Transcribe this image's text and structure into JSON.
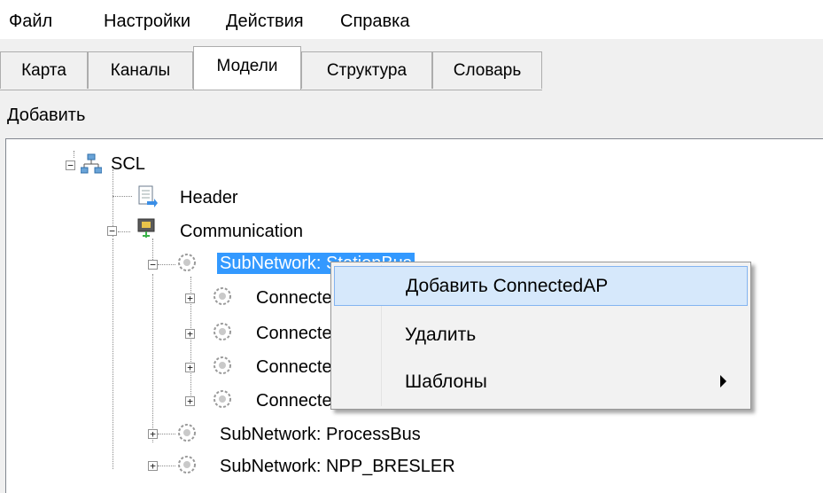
{
  "menubar": {
    "items": [
      "Файл",
      "Настройки",
      "Действия",
      "Справка"
    ]
  },
  "tabs": {
    "items": [
      "Карта",
      "Каналы",
      "Модели",
      "Структура",
      "Словарь"
    ],
    "active": "Модели"
  },
  "toolbar": {
    "add_label": "Добавить"
  },
  "tree": {
    "nodes": [
      {
        "label": "SCL",
        "expanded": true,
        "icon": "network-icon"
      },
      {
        "label": "Header",
        "icon": "document-icon"
      },
      {
        "label": "Communication",
        "expanded": true,
        "icon": "ethernet-port-icon"
      },
      {
        "label": "SubNetwork: StationBus",
        "expanded": true,
        "selected": true,
        "icon": "subnetwork-icon"
      },
      {
        "label": "ConnectedAP",
        "icon": "subnetwork-icon"
      },
      {
        "label": "ConnectedAP",
        "icon": "subnetwork-icon"
      },
      {
        "label": "ConnectedAP",
        "icon": "subnetwork-icon"
      },
      {
        "label": "ConnectedAP",
        "icon": "subnetwork-icon"
      },
      {
        "label": "SubNetwork: ProcessBus",
        "icon": "subnetwork-icon"
      },
      {
        "label": "SubNetwork: NPP_BRESLER",
        "icon": "subnetwork-icon"
      }
    ]
  },
  "context_menu": {
    "items": [
      {
        "label": "Добавить ConnectedAP",
        "highlighted": true
      },
      {
        "label": "Удалить"
      },
      {
        "label": "Шаблоны",
        "has_submenu": true
      }
    ]
  },
  "colors": {
    "selection": "#3399ff",
    "menu_hover": "#d6e8fb",
    "menu_hover_border": "#84b4f0"
  }
}
